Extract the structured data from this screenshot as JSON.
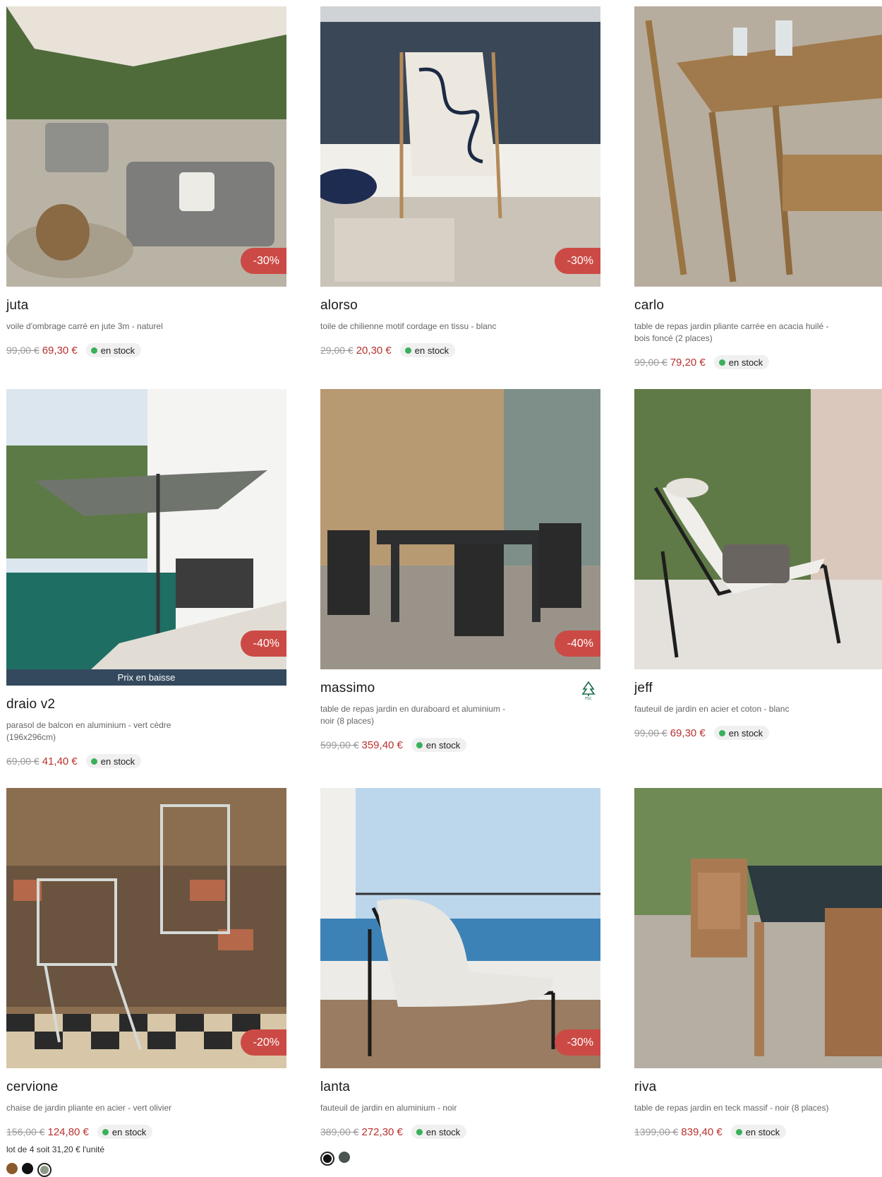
{
  "products": [
    {
      "name": "juta",
      "description": "voile d'ombrage carré en jute 3m - naturel",
      "old_price": "99,00 €",
      "new_price": "69,30 €",
      "discount": "-30%",
      "stock": "en stock"
    },
    {
      "name": "alorso",
      "description": "toile de chilienne motif cordage en tissu - blanc",
      "old_price": "29,00 €",
      "new_price": "20,30 €",
      "discount": "-30%",
      "stock": "en stock"
    },
    {
      "name": "carlo",
      "description": "table de repas jardin pliante carrée en acacia huilé - bois foncé (2 places)",
      "old_price": "99,00 €",
      "new_price": "79,20 €",
      "discount": "",
      "stock": "en stock"
    },
    {
      "name": "draio v2",
      "description": "parasol de balcon en aluminium - vert cèdre (196x296cm)",
      "old_price": "69,00 €",
      "new_price": "41,40 €",
      "discount": "-40%",
      "stock": "en stock",
      "banner": "Prix en baisse"
    },
    {
      "name": "massimo",
      "description": "table de repas jardin en duraboard et aluminium - noir (8 places)",
      "old_price": "599,00 €",
      "new_price": "359,40 €",
      "discount": "-40%",
      "stock": "en stock",
      "label_icon": "fsc-tree-icon"
    },
    {
      "name": "jeff",
      "description": "fauteuil de jardin en acier et coton - blanc",
      "old_price": "99,00 €",
      "new_price": "69,30 €",
      "discount": "",
      "stock": "en stock"
    },
    {
      "name": "cervione",
      "description": "chaise de jardin pliante en acier - vert olivier",
      "old_price": "156,00 €",
      "new_price": "124,80 €",
      "discount": "-20%",
      "stock": "en stock",
      "lot": "lot de 4 soit 31,20 € l'unité",
      "swatches": [
        "#8a5a2b",
        "#111111",
        "#8d9a86"
      ]
    },
    {
      "name": "lanta",
      "description": "fauteuil de jardin en aluminium - noir",
      "old_price": "389,00 €",
      "new_price": "272,30 €",
      "discount": "-30%",
      "stock": "en stock",
      "swatches": [
        "#111111",
        "#4a5550"
      ]
    },
    {
      "name": "riva",
      "description": "table de repas jardin en teck massif - noir (8 places)",
      "old_price": "1399,00 €",
      "new_price": "839,40 €",
      "discount": "",
      "stock": "en stock"
    }
  ],
  "colors": {
    "discount": "#cc4a45",
    "price": "#b8322f",
    "stock_dot": "#3bb05a",
    "banner": "#34495e"
  }
}
